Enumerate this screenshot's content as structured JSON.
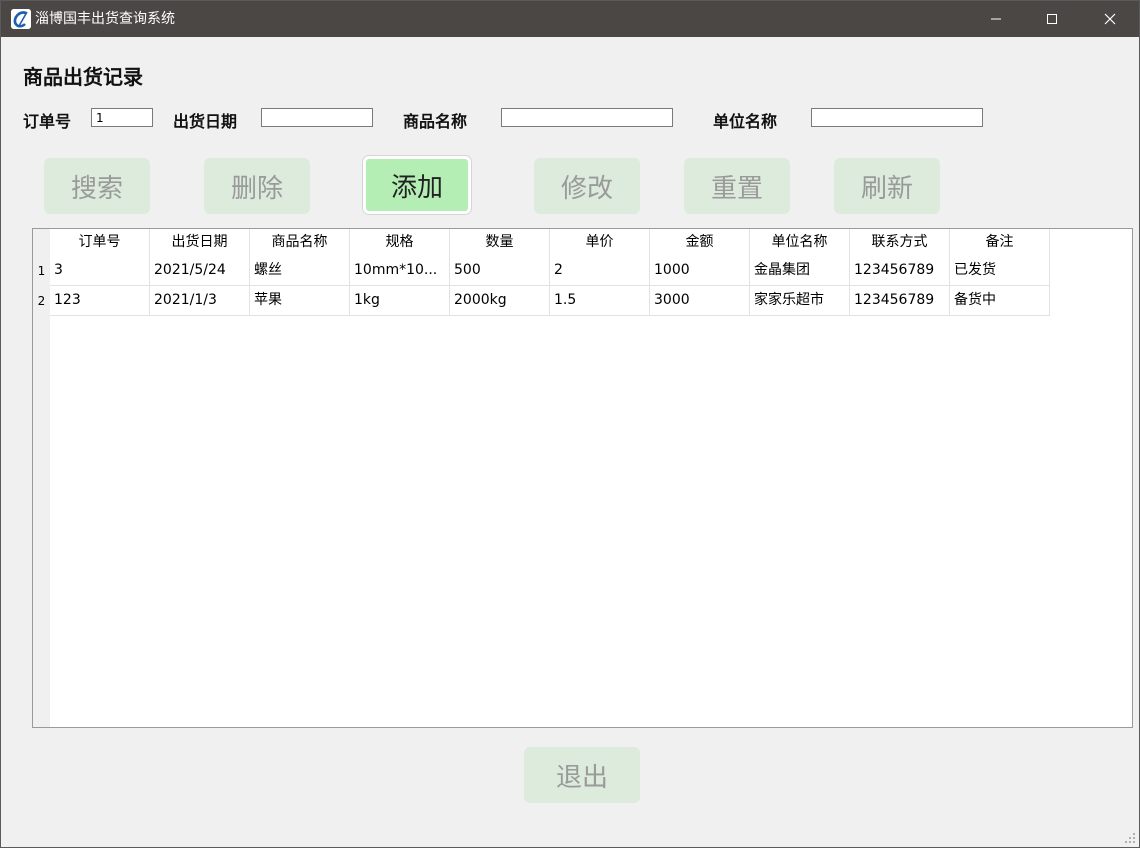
{
  "window": {
    "title": "淄博国丰出货查询系统"
  },
  "heading": "商品出货记录",
  "filters": {
    "order_no": {
      "label": "订单号",
      "value": "1"
    },
    "ship_date": {
      "label": "出货日期",
      "value": ""
    },
    "product_name": {
      "label": "商品名称",
      "value": ""
    },
    "company_name": {
      "label": "单位名称",
      "value": ""
    }
  },
  "buttons": {
    "search": "搜索",
    "delete": "删除",
    "add": "添加",
    "modify": "修改",
    "reset": "重置",
    "refresh": "刷新",
    "exit": "退出"
  },
  "table": {
    "columns": [
      "订单号",
      "出货日期",
      "商品名称",
      "规格",
      "数量",
      "单价",
      "金额",
      "单位名称",
      "联系方式",
      "备注"
    ],
    "rows": [
      {
        "num": "1",
        "cells": [
          "3",
          "2021/5/24",
          "螺丝",
          "10mm*10...",
          "500",
          "2",
          "1000",
          "金晶集团",
          "123456789",
          "已发货"
        ]
      },
      {
        "num": "2",
        "cells": [
          "123",
          "2021/1/3",
          "苹果",
          "1kg",
          "2000kg",
          "1.5",
          "3000",
          "家家乐超市",
          "123456789",
          "备货中"
        ]
      }
    ]
  },
  "colors": {
    "titlebar": "#4a4744",
    "button_bg": "#dcebdc",
    "button_active_bg": "#b5eeb5"
  },
  "icons": [
    "app-logo-icon",
    "minimize-icon",
    "maximize-icon",
    "close-icon",
    "resize-grip-icon"
  ]
}
